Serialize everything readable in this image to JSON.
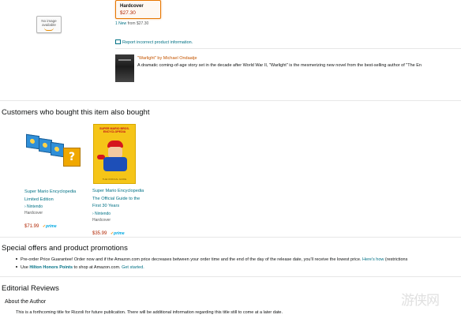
{
  "top": {
    "no_image_text": "No image available",
    "format": {
      "name": "Hardcover",
      "price": "$27.30"
    },
    "new_from": {
      "prefix": "1 New",
      "middle": " from ",
      "price": "$27.30"
    },
    "report_link": "Report incorrect product information."
  },
  "promo": {
    "title": "\"Warlight\" by Michael Ondaatje",
    "description": "A dramatic coming-of-age story set in the decade after World War II, \"Warlight\" is the mesmerizing new novel from the best-selling author of \"The En"
  },
  "also_bought": {
    "heading": "Customers who bought this item also bought",
    "products": [
      {
        "title_line1": "Super Mario Encyclopedia",
        "title_line2": "Limited Edition",
        "title_line3": "",
        "author": "› Nintendo",
        "format": "Hardcover",
        "price": "$71.99",
        "prime": "prime"
      },
      {
        "title_line1": "Super Mario Encyclopedia",
        "title_line2": "The Official Guide to the",
        "title_line3": "First 30 Years",
        "author": "› Nintendo",
        "format": "Hardcover",
        "price": "$35.99",
        "prime": "prime",
        "cover_title": "SUPER MARIO BROS. ENCYCLOPEDIA",
        "cover_footer": "THE OFFICIAL GUIDE"
      }
    ]
  },
  "special_offers": {
    "heading": "Special offers and product promotions",
    "items": [
      {
        "text": "Pre-order Price Guarantee! Order now and if the Amazon.com price decreases between your order time and the end of the day of the release date, you'll receive the lowest price. ",
        "link": "Here's how",
        "suffix": " (restrictions"
      },
      {
        "prefix": "Use ",
        "link": "Hilton Honors Points",
        "text": " to shop at Amazon.com. ",
        "link2": "Get started."
      }
    ]
  },
  "editorial": {
    "heading": "Editorial Reviews",
    "subheading": "About the Author",
    "body": "This is a forthcoming title for Rizzoli for future publication. There will be additional information regarding this title still to come at a later date."
  },
  "watermark": "游侠网",
  "colors": {
    "link": "#007185",
    "price": "#b12704",
    "accent": "#e77600",
    "author_orange": "#c45500",
    "prime": "#00a8e1"
  }
}
